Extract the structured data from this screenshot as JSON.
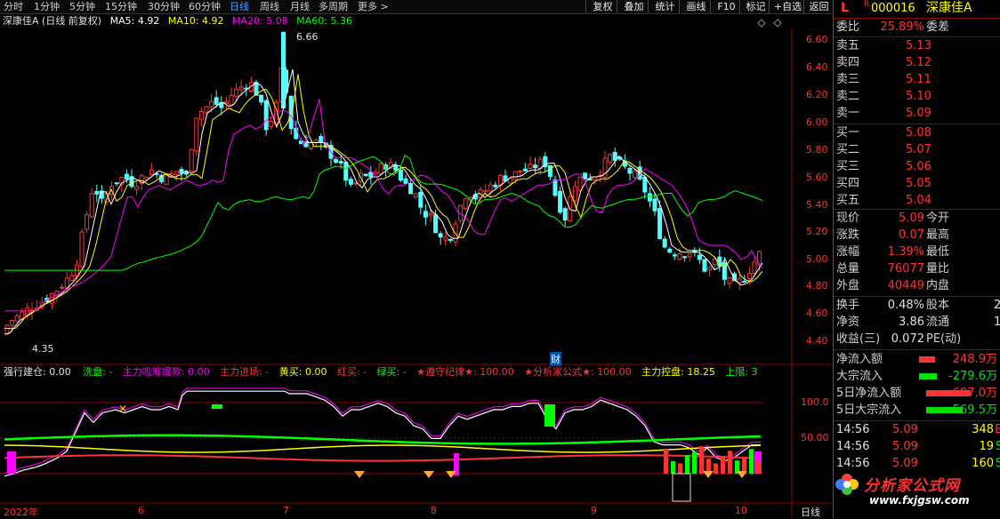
{
  "toolbar": {
    "periods": [
      "分时",
      "1分钟",
      "5分钟",
      "15分钟",
      "30分钟",
      "60分钟",
      "日线",
      "周线",
      "月线",
      "多周期",
      "更多 >"
    ],
    "active_period": "日线",
    "buttons": [
      "复权",
      "叠加",
      "统计",
      "画线",
      "F10",
      "标记",
      "+自选",
      "返回"
    ]
  },
  "chart_header": {
    "stock": "深康佳A (日线 前复权)",
    "ma5": "MA5: 4.92",
    "ma10": "MA10: 4.92",
    "ma20": "MA20: 5.08",
    "ma60": "MA60: 5.36"
  },
  "price_axis": [
    "6.60",
    "6.40",
    "6.20",
    "6.00",
    "5.80",
    "5.60",
    "5.40",
    "5.20",
    "5.00",
    "4.80",
    "4.60",
    "4.40"
  ],
  "annotations": {
    "high": "6.66",
    "low": "4.35",
    "cai": "财"
  },
  "indicator_header": {
    "name": "强行建仓",
    "value": ": 0.00",
    "items": [
      {
        "text": "洗盘: -",
        "color": "#00ff00"
      },
      {
        "text": "主力吸筹提款: 0.00",
        "color": "#ff00ff"
      },
      {
        "text": "主力进场: -",
        "color": "#ff3333"
      },
      {
        "text": "黄买: 0.00",
        "color": "#ffff00"
      },
      {
        "text": "红买: -",
        "color": "#ff3333"
      },
      {
        "text": "绿买: -",
        "color": "#00ff00"
      },
      {
        "text": "★遵守纪律★: 100.00",
        "color": "#ff3333"
      },
      {
        "text": "★分析家公式★: 100.00",
        "color": "#ff3333"
      },
      {
        "text": "主力控盘: 18.25",
        "color": "#ffff00"
      },
      {
        "text": "上限: 3",
        "color": "#00ff00"
      }
    ]
  },
  "indicator_axis": [
    "100.0",
    "50.00"
  ],
  "x_axis": [
    "2022年",
    "6",
    "7",
    "8",
    "9",
    "10"
  ],
  "x_axis_right": "日线",
  "quote": {
    "flag": "L",
    "r": "R",
    "code": "000016",
    "name": "深康佳A",
    "weibi_label": "委比",
    "weibi": "25.89%",
    "weicha_label": "委差",
    "asks": [
      {
        "label": "卖五",
        "price": "5.13"
      },
      {
        "label": "卖四",
        "price": "5.12"
      },
      {
        "label": "卖三",
        "price": "5.11"
      },
      {
        "label": "卖二",
        "price": "5.10"
      },
      {
        "label": "卖一",
        "price": "5.09"
      }
    ],
    "bids": [
      {
        "label": "买一",
        "price": "5.08"
      },
      {
        "label": "买二",
        "price": "5.07"
      },
      {
        "label": "买三",
        "price": "5.06"
      },
      {
        "label": "买四",
        "price": "5.05"
      },
      {
        "label": "买五",
        "price": "5.04"
      }
    ],
    "stats": [
      {
        "label": "现价",
        "value": "5.09",
        "label2": "今开"
      },
      {
        "label": "涨跌",
        "value": "0.07",
        "label2": "最高"
      },
      {
        "label": "涨幅",
        "value": "1.39%",
        "label2": "最低"
      },
      {
        "label": "总量",
        "value": "76077",
        "label2": "量比"
      },
      {
        "label": "外盘",
        "value": "40449",
        "label2": "内盘"
      }
    ],
    "stats2": [
      {
        "label": "换手",
        "value": "0.48%",
        "label2": "股本",
        "v2": "2"
      },
      {
        "label": "净资",
        "value": "3.86",
        "label2": "流通",
        "v2": "1"
      },
      {
        "label": "收益(三)",
        "value": "0.072",
        "label2": "PE(动)",
        "v2": ""
      }
    ],
    "flows": [
      {
        "label": "净流入额",
        "value": "248.9万",
        "color": "#ff3333",
        "bar": 0.36
      },
      {
        "label": "大宗流入",
        "value": "-279.6万",
        "color": "#00e000",
        "bar": 0.4
      },
      {
        "label": "5日净流入额",
        "value": "697.0万",
        "color": "#ff3333",
        "bar": 1.0
      },
      {
        "label": "5日大宗流入",
        "value": "-569.5万",
        "color": "#00e000",
        "bar": 0.82
      }
    ],
    "ticks": [
      {
        "time": "14:56",
        "price": "5.09",
        "vol": "348",
        "flag": "B"
      },
      {
        "time": "14:56",
        "price": "5.09",
        "vol": "19",
        "flag": "S"
      },
      {
        "time": "14:56",
        "price": "5.09",
        "vol": "160",
        "flag": "S"
      }
    ]
  },
  "watermark": {
    "text": "分析家公式网",
    "url": "www.fxjgsw.com"
  },
  "colors": {
    "up": "#ff3333",
    "down": "#54ffff",
    "ma5": "#ffffff",
    "ma10": "#ffff00",
    "ma20": "#ff00ff",
    "ma60": "#00ff00"
  }
}
